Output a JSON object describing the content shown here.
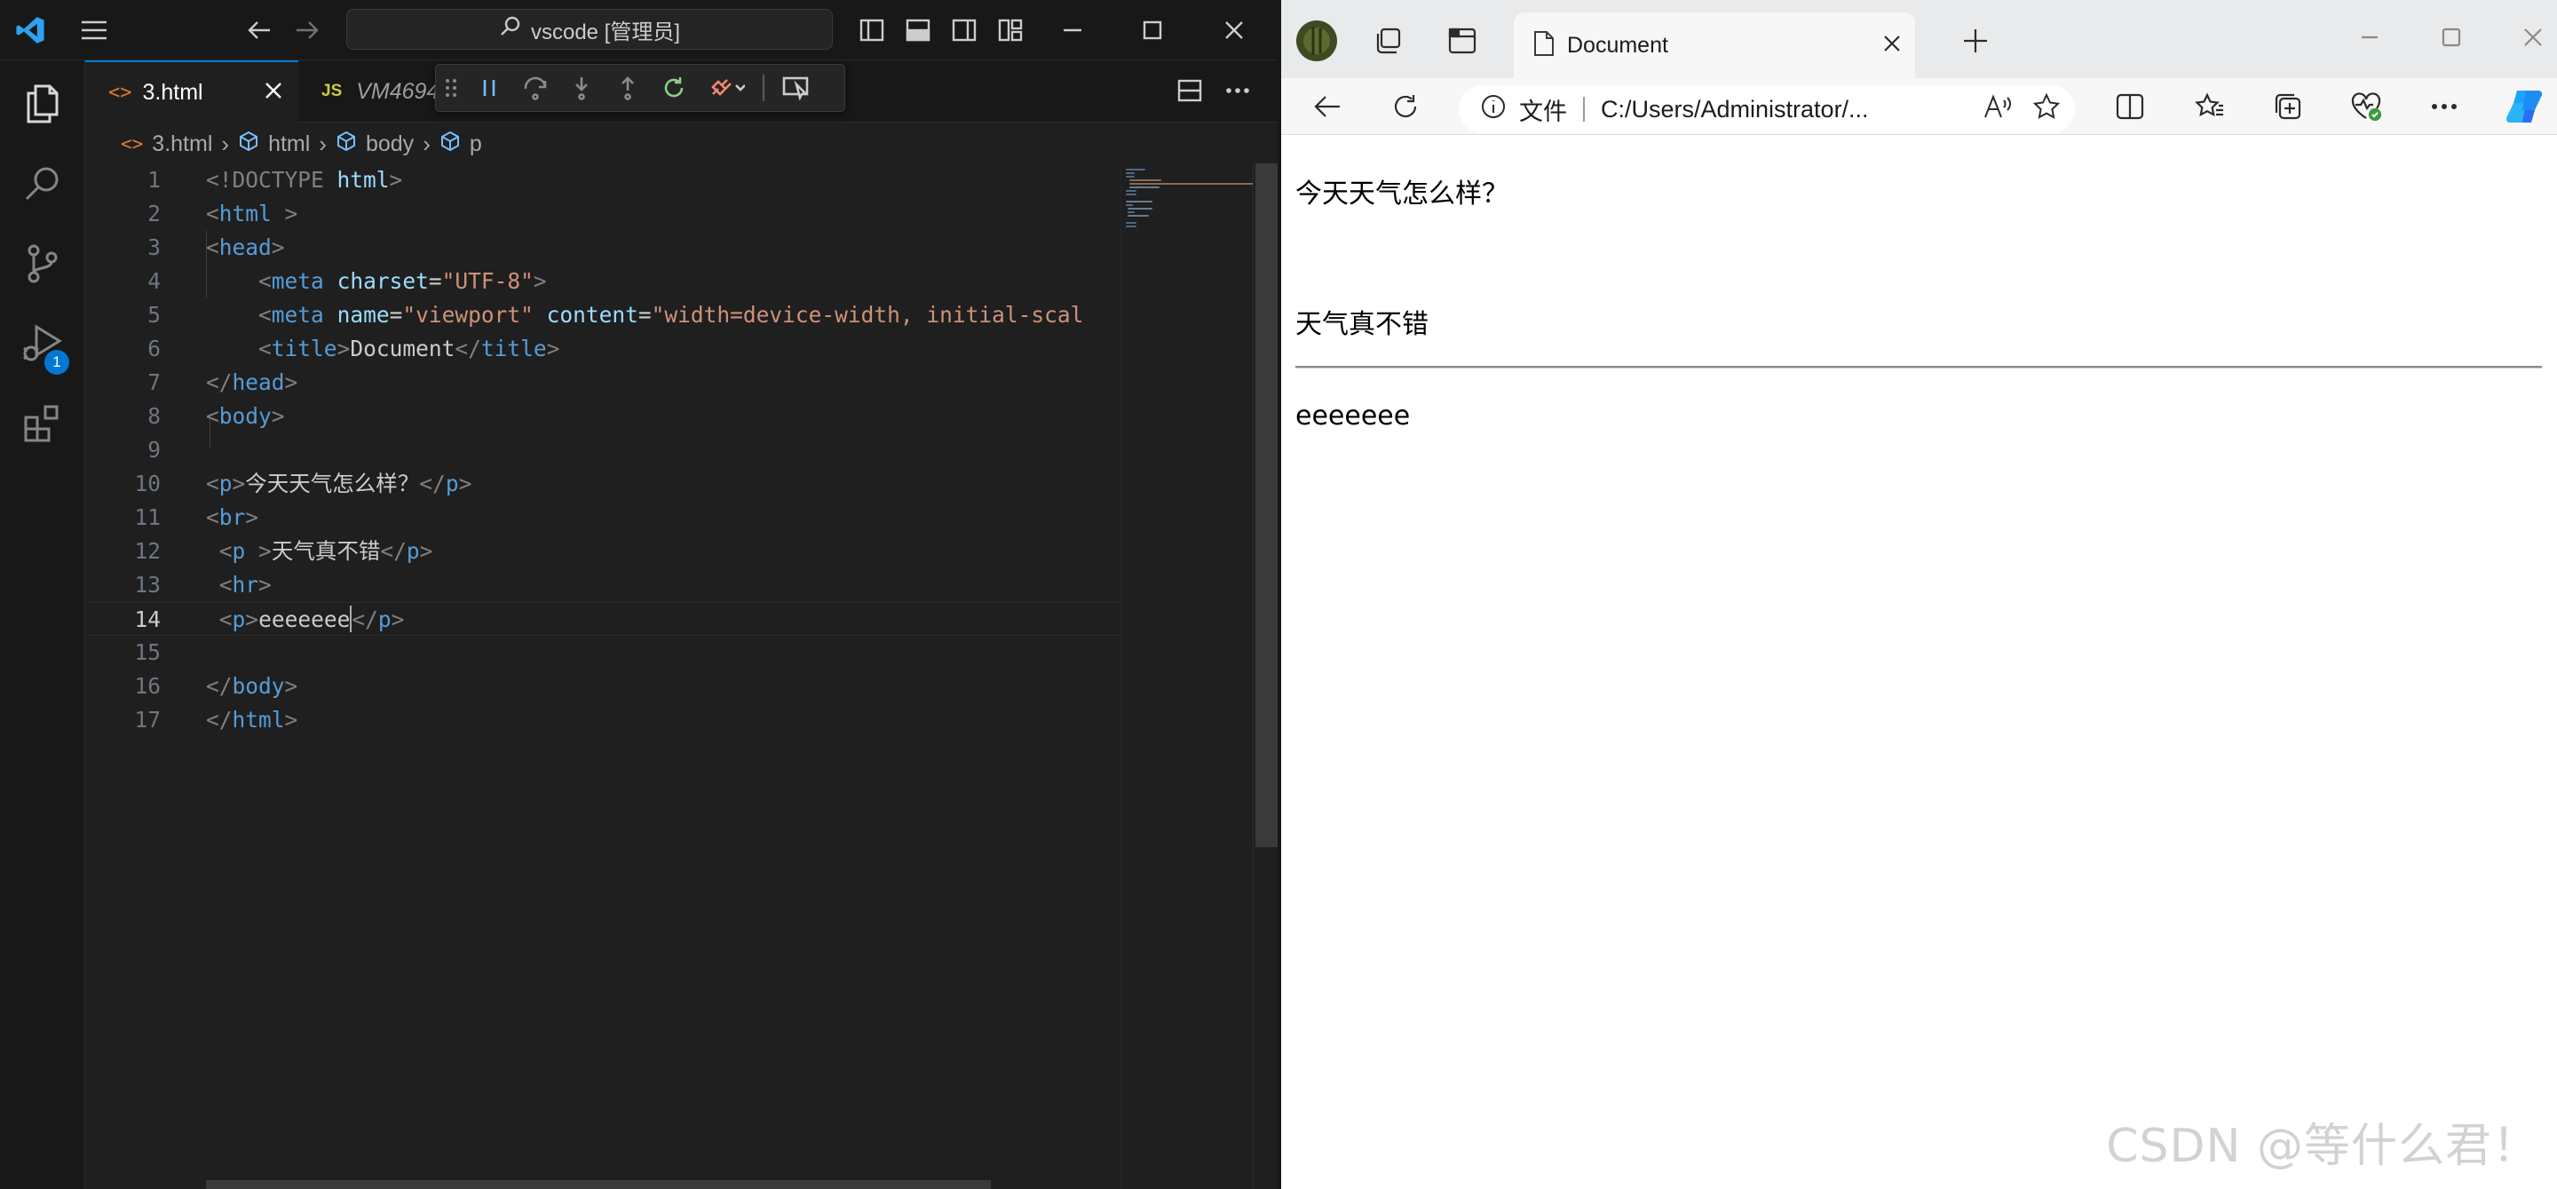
{
  "vscode": {
    "title": "vscode [管理员]",
    "tabs": [
      {
        "label": "3.html",
        "active": true
      },
      {
        "label": "VM4694",
        "active": false
      }
    ],
    "breadcrumb": [
      "3.html",
      "html",
      "body",
      "p"
    ],
    "debug_badge": "1",
    "line_numbers": [
      "1",
      "2",
      "3",
      "4",
      "5",
      "6",
      "7",
      "8",
      "9",
      "10",
      "11",
      "12",
      "13",
      "14",
      "15",
      "16",
      "17"
    ],
    "current_line": 14,
    "code": {
      "l1_doctype": "<!DOCTYPE",
      "l1_html": "html",
      "l2_html": "html",
      "l3_head": "head",
      "l4_meta": "meta",
      "l4_attr": "charset",
      "l4_val": "\"UTF-8\"",
      "l5_meta": "meta",
      "l5_attr1": "name",
      "l5_val1": "\"viewport\"",
      "l5_attr2": "content",
      "l5_val2": "\"width=device-width, initial-scal",
      "l6_title": "title",
      "l6_text": "Document",
      "l7_head": "head",
      "l8_body": "body",
      "l10_p": "p",
      "l10_text": "今天天气怎么样？",
      "l11_br": "br",
      "l12_p": "p",
      "l12_text": "天气真不错",
      "l13_hr": "hr",
      "l14_p": "p",
      "l14_text": "eeeeeee",
      "l16_body": "body",
      "l17_html": "html"
    },
    "colors": {
      "tag": "#569cd6",
      "attr": "#9cdcfe",
      "string": "#ce9178",
      "accent": "#0078d4"
    }
  },
  "edge": {
    "tab_title": "Document",
    "address_label": "文件",
    "address_url": "C:/Users/Administrator/...",
    "page": {
      "p1": "今天天气怎么样？",
      "p2": "天气真不错",
      "p3": "eeeeeee"
    },
    "watermark": "CSDN @等什么君！"
  }
}
